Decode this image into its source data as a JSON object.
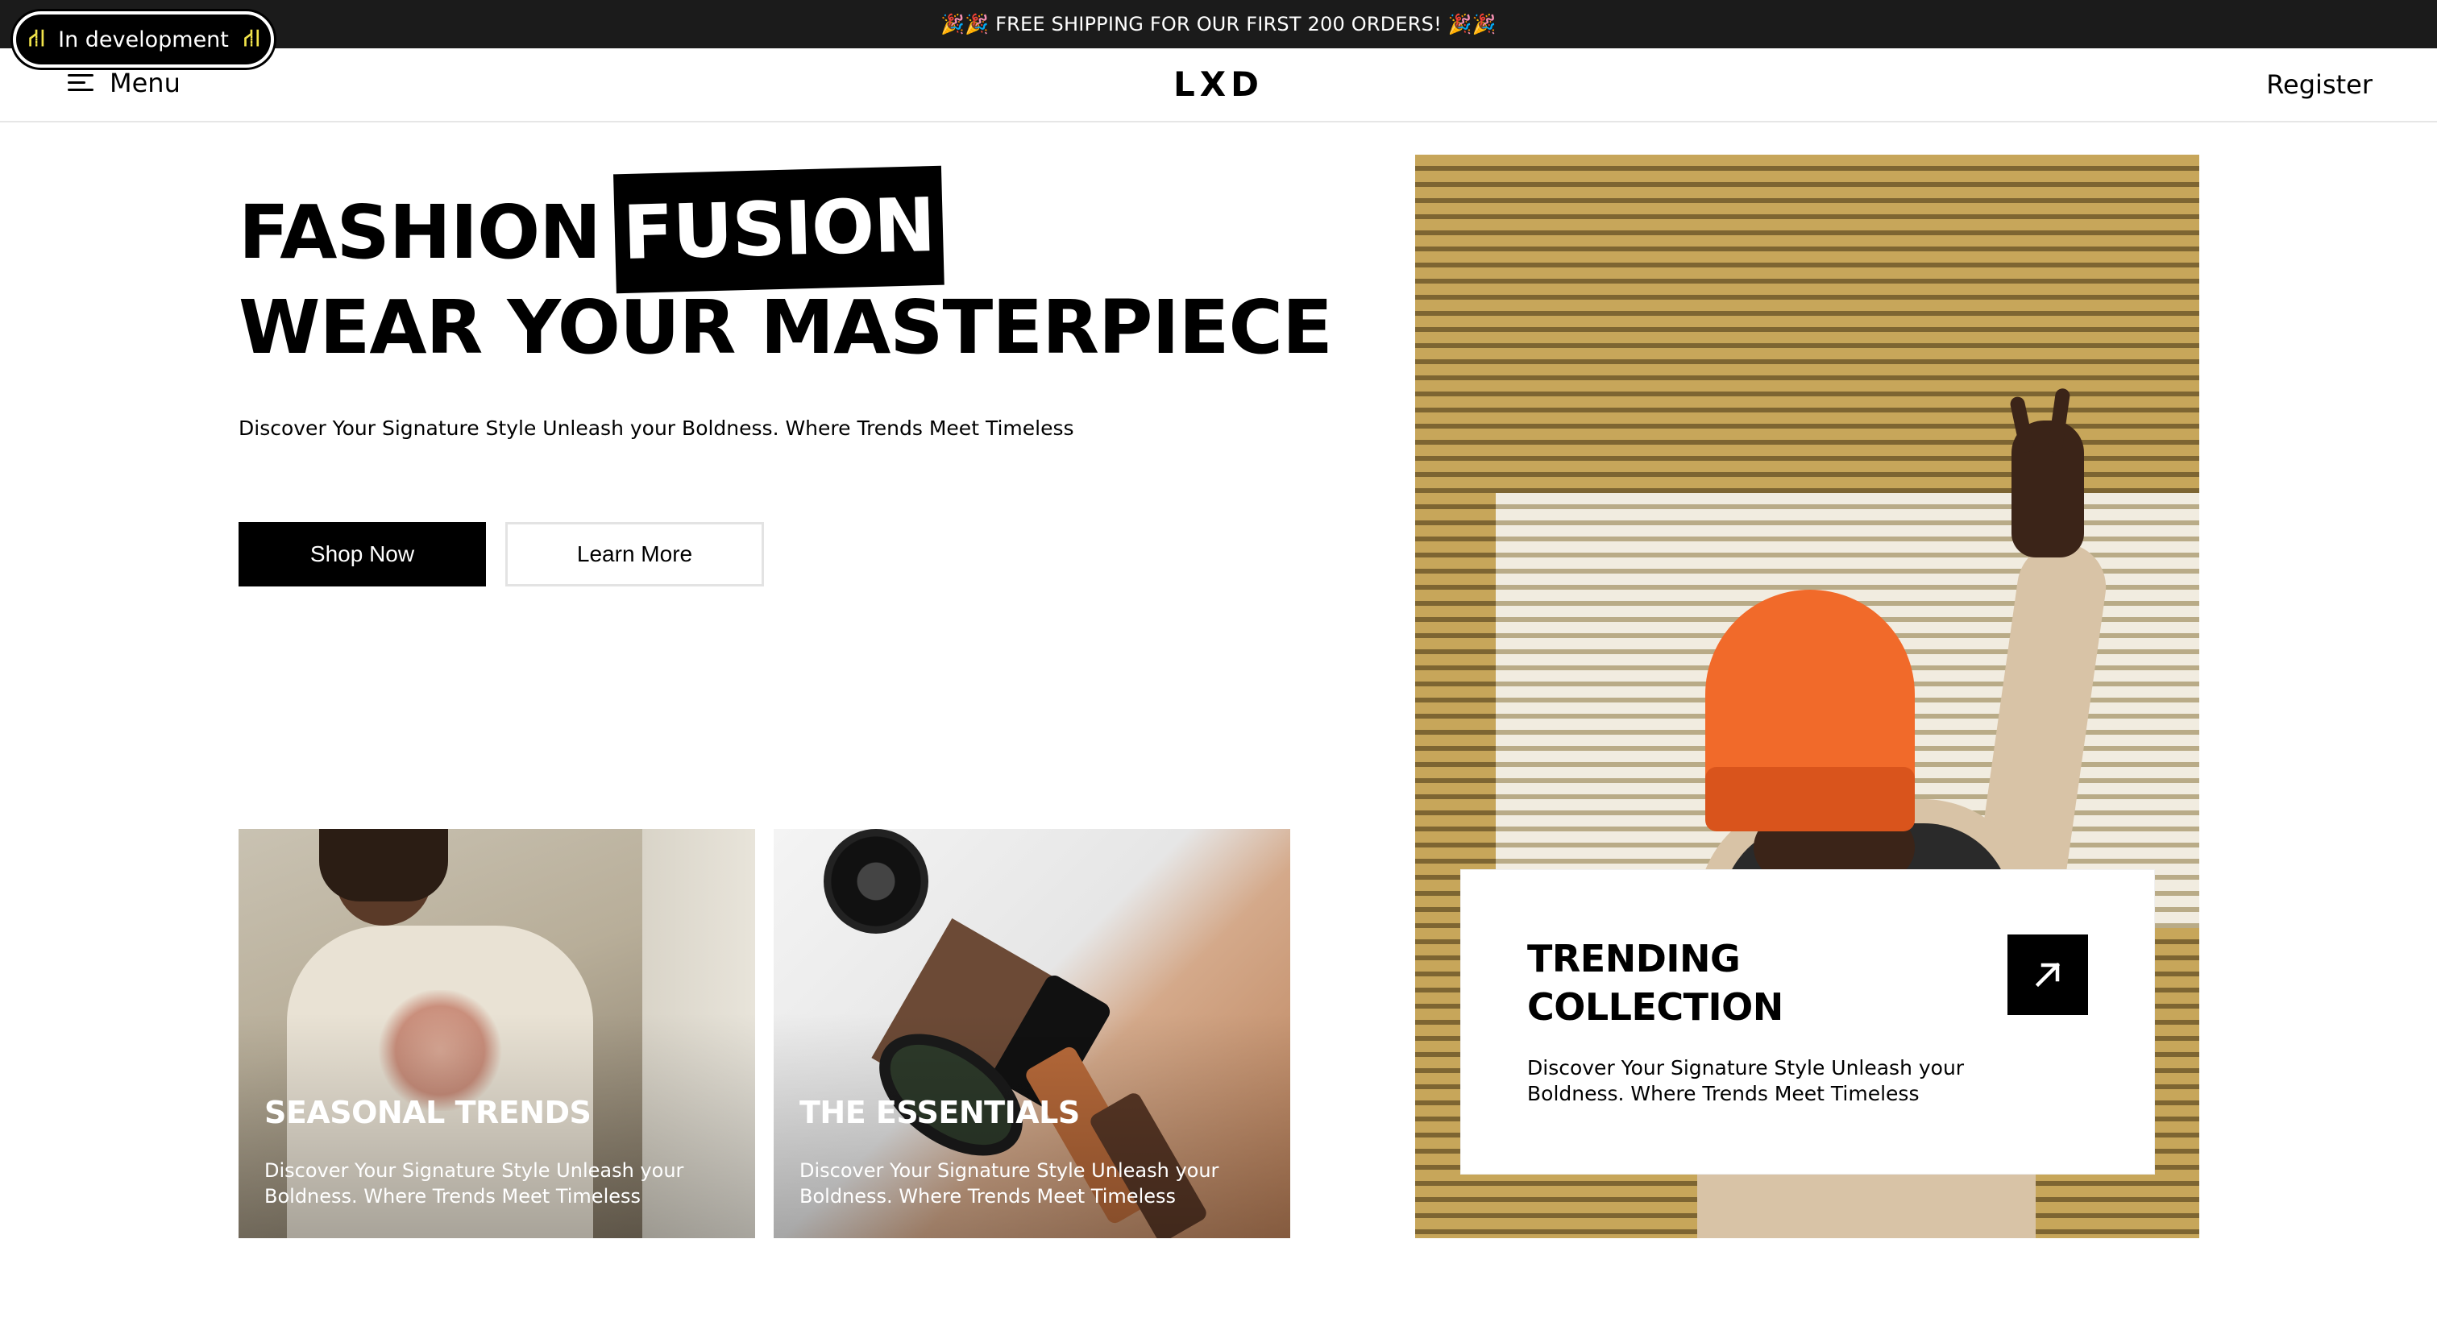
{
  "dev_badge": {
    "label": "In development",
    "icon": "roadblock-icon"
  },
  "announcement": {
    "text": "🎉🎉 FREE SHIPPING FOR OUR FIRST 200 ORDERS! 🎉🎉"
  },
  "header": {
    "menu_label": "Menu",
    "logo": "LXD",
    "register_label": "Register"
  },
  "hero": {
    "title_word": "FASHION",
    "title_highlight": "FUSION",
    "title_line2": "WEAR YOUR MASTERPIECE",
    "subtitle": "Discover Your Signature Style Unleash your Boldness. Where Trends Meet Timeless",
    "primary_button": "Shop Now",
    "secondary_button": "Learn More"
  },
  "cards": [
    {
      "title": "SEASONAL TRENDS",
      "description": "Discover Your Signature Style Unleash your Boldness. Where Trends Meet Timeless"
    },
    {
      "title": "THE ESSENTIALS",
      "description": "Discover Your Signature Style Unleash your Boldness. Where Trends Meet Timeless"
    }
  ],
  "trending": {
    "title_line1": "TRENDING",
    "title_line2": "COLLECTION",
    "description": "Discover Your Signature Style Unleash your Boldness. Where Trends Meet Timeless",
    "icon": "arrow-up-right-icon"
  },
  "colors": {
    "bar": "#1b1b1b",
    "accent": "#000000",
    "badge_icon": "#f2e44a",
    "beanie": "#f16a2a"
  }
}
